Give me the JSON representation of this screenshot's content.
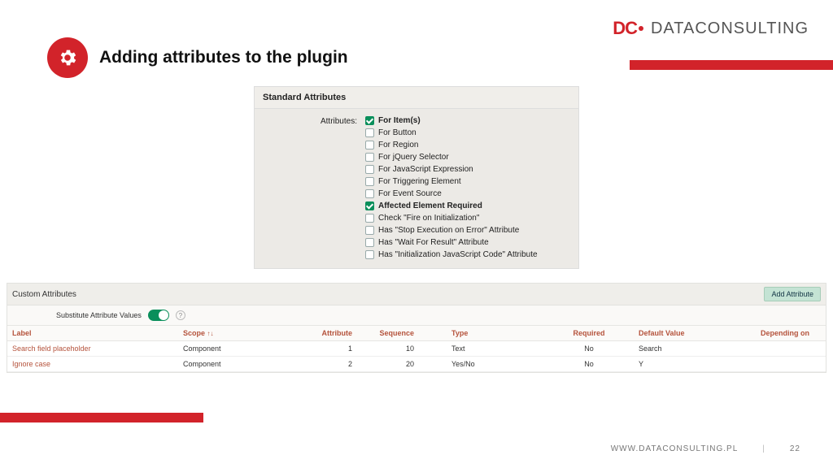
{
  "brand": {
    "mark": "DC",
    "name": "DATACONSULTING"
  },
  "title": "Adding attributes to the plugin",
  "std_panel": {
    "header": "Standard Attributes",
    "label": "Attributes:",
    "items": [
      {
        "label": "For Item(s)",
        "checked": true,
        "bold": true
      },
      {
        "label": "For Button",
        "checked": false,
        "bold": false
      },
      {
        "label": "For Region",
        "checked": false,
        "bold": false
      },
      {
        "label": "For jQuery Selector",
        "checked": false,
        "bold": false
      },
      {
        "label": "For JavaScript Expression",
        "checked": false,
        "bold": false
      },
      {
        "label": "For Triggering Element",
        "checked": false,
        "bold": false
      },
      {
        "label": "For Event Source",
        "checked": false,
        "bold": false
      },
      {
        "label": "Affected Element Required",
        "checked": true,
        "bold": true
      },
      {
        "label": "Check \"Fire on Initialization\"",
        "checked": false,
        "bold": false
      },
      {
        "label": "Has \"Stop Execution on Error\" Attribute",
        "checked": false,
        "bold": false
      },
      {
        "label": "Has \"Wait For Result\" Attribute",
        "checked": false,
        "bold": false
      },
      {
        "label": "Has \"Initialization JavaScript Code\" Attribute",
        "checked": false,
        "bold": false
      }
    ]
  },
  "cust_panel": {
    "title": "Custom Attributes",
    "add_button": "Add Attribute",
    "substitute_label": "Substitute Attribute Values",
    "columns": {
      "label": "Label",
      "scope": "Scope",
      "scope_sort": "↑↓",
      "attribute": "Attribute",
      "sequence": "Sequence",
      "type": "Type",
      "required": "Required",
      "default": "Default Value",
      "depending": "Depending on"
    },
    "rows": [
      {
        "label": "Search field placeholder",
        "scope": "Component",
        "attribute": "1",
        "sequence": "10",
        "type": "Text",
        "required": "No",
        "default": "Search",
        "depending": ""
      },
      {
        "label": "Ignore case",
        "scope": "Component",
        "attribute": "2",
        "sequence": "20",
        "type": "Yes/No",
        "required": "No",
        "default": "Y",
        "depending": ""
      }
    ]
  },
  "footer": {
    "url": "WWW.DATACONSULTING.PL",
    "page": "22"
  }
}
